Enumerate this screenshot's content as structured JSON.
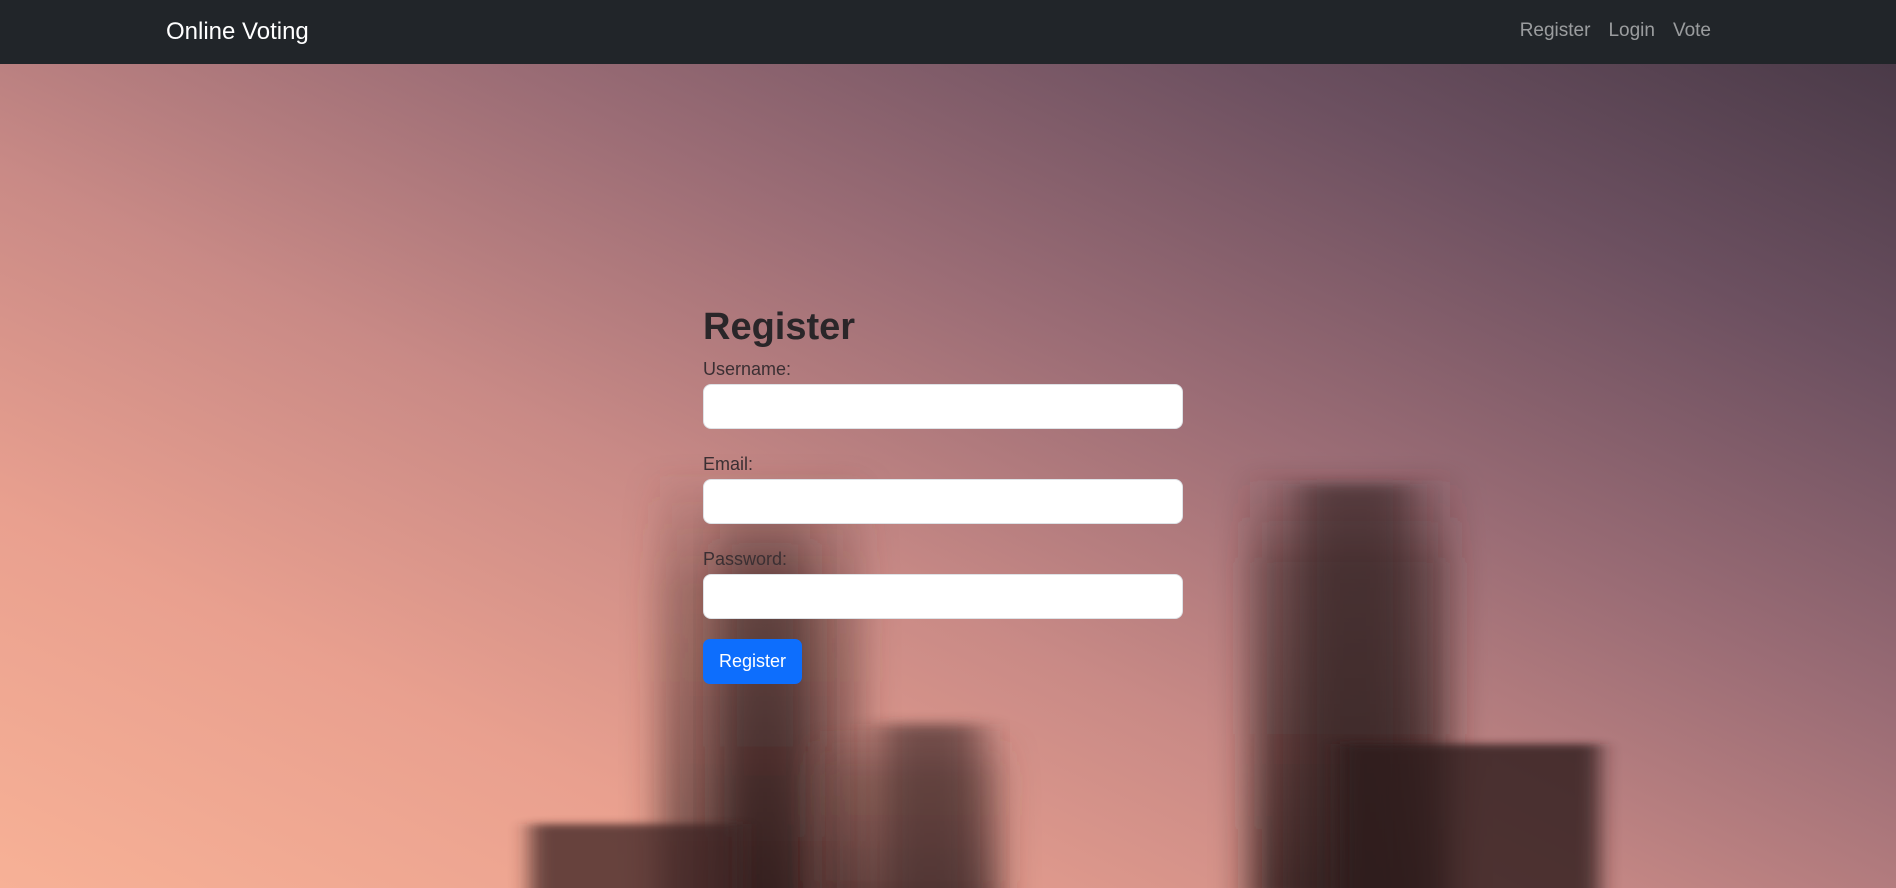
{
  "navbar": {
    "brand": "Online Voting",
    "links": [
      {
        "label": "Register"
      },
      {
        "label": "Login"
      },
      {
        "label": "Vote"
      }
    ]
  },
  "form": {
    "title": "Register",
    "username_label": "Username:",
    "username_value": "",
    "email_label": "Email:",
    "email_value": "",
    "password_label": "Password:",
    "password_value": "",
    "submit_label": "Register"
  },
  "colors": {
    "navbar_bg": "#212529",
    "accent": "#0d6efd"
  }
}
